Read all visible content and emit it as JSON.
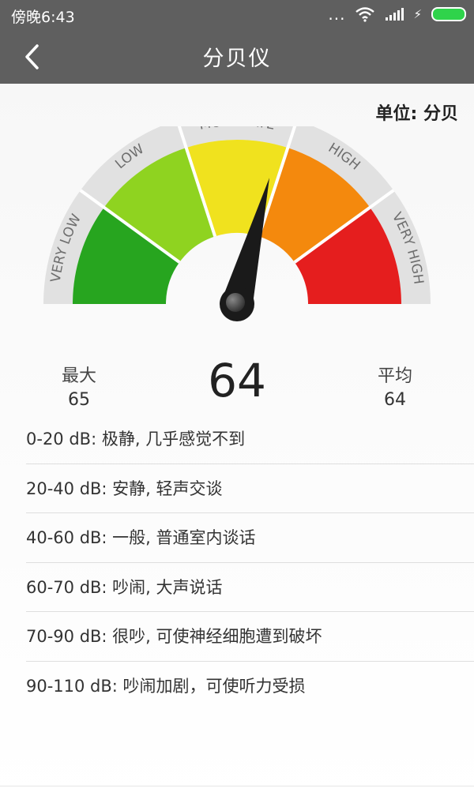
{
  "status_bar": {
    "time": "傍晚6:43",
    "more_dots": "...",
    "charging_symbol": "⚡"
  },
  "header": {
    "title": "分贝仪"
  },
  "unit_label": "单位: 分贝",
  "gauge": {
    "segments": [
      {
        "label": "VERY LOW",
        "color": "#27a51f"
      },
      {
        "label": "LOW",
        "color": "#8fd320"
      },
      {
        "label": "MODERATE",
        "color": "#f0e21e"
      },
      {
        "label": "HIGH",
        "color": "#f4890d"
      },
      {
        "label": "VERY HIGH",
        "color": "#e51e1e"
      }
    ],
    "needle_fraction": 0.58
  },
  "stats": {
    "max_label": "最大",
    "max_value": "65",
    "current_value": "64",
    "avg_label": "平均",
    "avg_value": "64"
  },
  "levels": [
    "0-20 dB: 极静, 几乎感觉不到",
    "20-40 dB: 安静, 轻声交谈",
    "40-60 dB: 一般, 普通室内谈话",
    "60-70 dB: 吵闹, 大声说话",
    "70-90 dB: 很吵, 可使神经细胞遭到破坏",
    "90-110 dB: 吵闹加剧，可使听力受损"
  ],
  "colors": {
    "topbar": "#5f5f5f"
  }
}
